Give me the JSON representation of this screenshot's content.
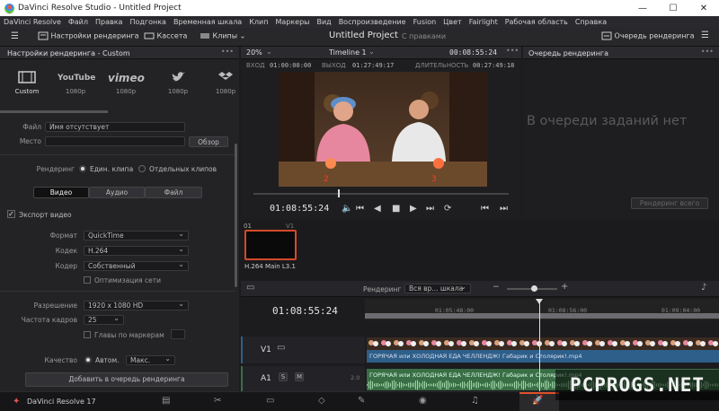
{
  "window": {
    "title": "DaVinci Resolve Studio - Untitled Project"
  },
  "menu": [
    "DaVinci Resolve",
    "Файл",
    "Правка",
    "Подгонка",
    "Временная шкала",
    "Клип",
    "Маркеры",
    "Вид",
    "Воспроизведение",
    "Fusion",
    "Цвет",
    "Fairlight",
    "Рабочая область",
    "Справка"
  ],
  "toolbar": {
    "render_settings": "Настройки рендеринга",
    "tape": "Кассета",
    "clips": "Клипы",
    "project_title": "Untitled Project",
    "saved_status": "С правками",
    "render_queue": "Очередь рендеринга"
  },
  "render_panel": {
    "title": "Настройки рендеринга - Custom",
    "presets": [
      {
        "name": "Custom",
        "res": "",
        "icon": "film-icon"
      },
      {
        "name": "YouTube",
        "res": "1080p",
        "icon": "youtube-icon"
      },
      {
        "name": "vimeo",
        "res": "1080p",
        "icon": "vimeo-icon"
      },
      {
        "name": "Twitter",
        "res": "1080p",
        "icon": "twitter-icon"
      },
      {
        "name": "Dropbox",
        "res": "1080p",
        "icon": "dropbox-icon"
      }
    ],
    "file_label": "Файл",
    "file_placeholder": "Имя отсутствует",
    "location_label": "Место",
    "browse": "Обзор",
    "render_label": "Рендеринг",
    "single_clip": "Един. клипа",
    "separate_clips": "Отдельных клипов",
    "tabs": [
      "Видео",
      "Аудио",
      "Файл"
    ],
    "export_video": "Экспорт видео",
    "format_label": "Формат",
    "format_value": "QuickTime",
    "codec_label": "Кодек",
    "codec_value": "H.264",
    "encoder_label": "Кодер",
    "encoder_value": "Собственный",
    "network_opt": "Оптимизация сети",
    "resolution_label": "Разрешение",
    "resolution_value": "1920 x 1080 HD",
    "fps_label": "Частота кадров",
    "fps_value": "25",
    "chapters": "Главы по маркерам",
    "quality_label": "Качество",
    "quality_auto": "Автом.",
    "quality_max": "Макс.",
    "add_to_queue": "Добавить в очередь рендеринга"
  },
  "viewer": {
    "zoom": "20%",
    "timeline_name": "Timeline 1",
    "timecode_top": "00:08:55:24",
    "in_label": "ВХОД",
    "in_value": "01:00:00:00",
    "out_label": "ВЫХОД",
    "out_value": "01:27:49:17",
    "duration_label": "ДЛИТЕЛЬНОСТЬ",
    "duration_value": "00:27:49:18",
    "current_tc": "01:08:55:24",
    "playhead_fraction": 0.33
  },
  "queue": {
    "title": "Очередь рендеринга",
    "empty": "В очереди заданий нет",
    "render_all": "Рендеринг всего"
  },
  "clip_strip": {
    "index": "01",
    "track": "V1",
    "clip_label": "H.264 Main L3.1"
  },
  "timeline": {
    "render_label": "Рендеринг",
    "range_value": "Вся вр... шкала",
    "timecode": "01:08:55:24",
    "ruler": [
      "01:05:48:00",
      "01:08:56:00",
      "01:09:04:00"
    ],
    "tracks": [
      {
        "id": "V1",
        "name": "",
        "clip": "ГОРЯЧАЯ или ХОЛОДНАЯ ЕДА ЧЕЛЛЕНДЖ! Габарик и Столярик!.mp4"
      },
      {
        "id": "A1",
        "name": "2.0",
        "clip": "ГОРЯЧАЯ или ХОЛОДНАЯ ЕДА ЧЕЛЛЕНДЖ! Габарик и Столярик!.mp4"
      }
    ]
  },
  "dock": {
    "app": "DaVinci Resolve 17",
    "watermark": "PCPROGS.NET"
  },
  "colors": {
    "accent": "#e0502a",
    "timeline_video": "#2d5f8a",
    "timeline_audio": "#3a6e45",
    "bg": "#1c1c1e"
  }
}
